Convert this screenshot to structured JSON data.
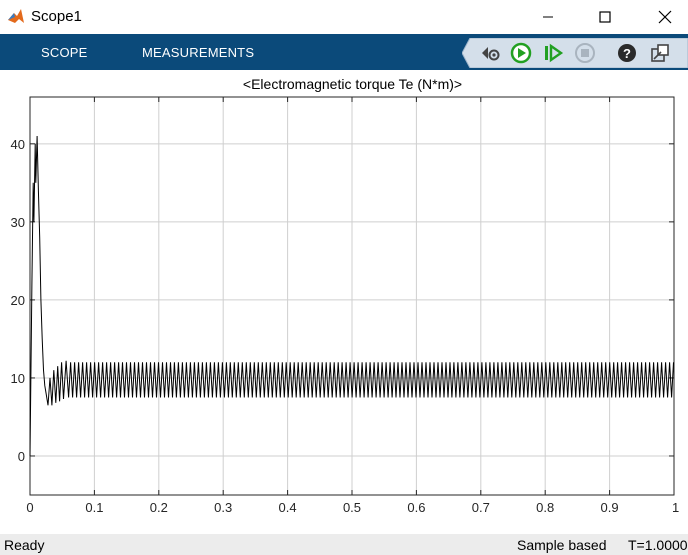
{
  "window": {
    "title": "Scope1"
  },
  "toolstrip": {
    "tabs": [
      "SCOPE",
      "MEASUREMENTS"
    ]
  },
  "quick_access": [
    {
      "icon": "settings-icon"
    },
    {
      "icon": "run-icon",
      "color": "#22a022"
    },
    {
      "icon": "step-forward-icon",
      "color": "#22a022"
    },
    {
      "icon": "stop-icon"
    },
    {
      "icon": "help-icon"
    },
    {
      "icon": "undock-icon"
    }
  ],
  "status": {
    "left": "Ready",
    "mode": "Sample based",
    "time": "T=1.0000"
  },
  "chart_data": {
    "type": "line",
    "title": "<Electromagnetic torque Te (N*m)>",
    "xlim": [
      0,
      1
    ],
    "ylim": [
      -5,
      46
    ],
    "xticks": [
      "0",
      "0.1",
      "0.2",
      "0.3",
      "0.4",
      "0.5",
      "0.6",
      "0.7",
      "0.8",
      "0.9",
      "1"
    ],
    "yticks": [
      "0",
      "10",
      "20",
      "30",
      "40"
    ],
    "grid": true,
    "line_color": "#000000",
    "series": [
      {
        "points": [
          [
            0.0,
            0
          ],
          [
            0.003,
            22
          ],
          [
            0.005,
            35
          ],
          [
            0.006,
            30
          ],
          [
            0.008,
            40
          ],
          [
            0.009,
            35
          ],
          [
            0.011,
            41
          ],
          [
            0.013,
            34
          ],
          [
            0.015,
            28
          ],
          [
            0.017,
            20
          ],
          [
            0.019,
            15
          ],
          [
            0.021,
            11
          ],
          [
            0.023,
            9
          ],
          [
            0.025,
            8
          ],
          [
            0.028,
            6.5
          ],
          [
            0.031,
            10
          ],
          [
            0.034,
            6.5
          ],
          [
            0.037,
            11
          ],
          [
            0.04,
            6.8
          ],
          [
            0.043,
            11.5
          ],
          [
            0.046,
            7
          ],
          [
            0.049,
            12
          ],
          [
            0.052,
            7.3
          ],
          [
            0.056,
            12.2
          ],
          [
            0.06,
            7.5
          ],
          [
            1.0,
            10
          ]
        ],
        "steady_state": {
          "from": 0.06,
          "to": 1.0,
          "min": 7.5,
          "max": 12
        }
      }
    ]
  }
}
